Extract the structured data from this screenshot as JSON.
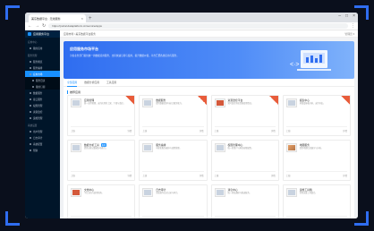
{
  "browser": {
    "tab_title": "美东数据平台 · 无线服务",
    "url": "https://portal.dataplatform.cn/service/apps"
  },
  "sidebar": {
    "app_name": "应用服务平台",
    "groups": [
      {
        "label": "应用中心",
        "items": [
          {
            "label": "我的应用"
          }
        ]
      },
      {
        "label": "服务管理",
        "items": [
          {
            "label": "服务概览"
          },
          {
            "label": "服务编排"
          },
          {
            "label": "应用市场",
            "active": true
          },
          {
            "label": "服务目录",
            "sub": true
          },
          {
            "label": "我的订阅",
            "sub": true
          },
          {
            "label": "数据服务"
          },
          {
            "label": "接口服务"
          },
          {
            "label": "权限管理"
          },
          {
            "label": "资源监控"
          },
          {
            "label": "运维管理"
          }
        ]
      },
      {
        "label": "系统设置",
        "items": [
          {
            "label": "用户管理"
          },
          {
            "label": "日志审计"
          },
          {
            "label": "系统配置"
          },
          {
            "label": "帮助"
          }
        ]
      }
    ]
  },
  "topbar": {
    "breadcrumb": "应用市场 / 美东数据平台服务",
    "right": "管理员 ▾"
  },
  "banner": {
    "title": "应用服务市场平台",
    "desc": "为各业务部门提供统一的数据应用服务，支持快速订阅与使用，提升数据价值。平台汇聚各类应用与服务。"
  },
  "tabs": [
    "全部应用",
    "数据分析应用",
    "工具应用"
  ],
  "section_title": "推荐应用",
  "cards": [
    {
      "title": "应用管理",
      "desc": "统一应用管理，支持应用的上架、下架与监控。",
      "thumb": "plain",
      "ribbon": true,
      "badge": "",
      "foot_left": "上线",
      "foot_right": "详情"
    },
    {
      "title": "数据服务",
      "desc": "提供数据查询与接口服务能力。",
      "thumb": "plain",
      "ribbon": true,
      "badge": "",
      "foot_left": "上线",
      "foot_right": "详情"
    },
    {
      "title": "资源监控平台",
      "desc": "实时监控系统资源使用情况。",
      "thumb": "red",
      "ribbon": true,
      "badge": "",
      "foot_left": "上线",
      "foot_right": "详情"
    },
    {
      "title": "报表中心",
      "desc": "多维度报表分析，支持导出。",
      "thumb": "plain",
      "ribbon": true,
      "badge": "",
      "foot_left": "上线",
      "foot_right": "详情"
    },
    {
      "title": "数据分析工具",
      "desc": "提供自助式数据分析能力。",
      "thumb": "plain",
      "ribbon": false,
      "badge": "推荐",
      "foot_left": "上线",
      "foot_right": "详情"
    },
    {
      "title": "服务编排",
      "desc": "可视化服务编排与流程管理。",
      "thumb": "plain",
      "ribbon": false,
      "badge": "",
      "foot_left": "上线",
      "foot_right": "详情"
    },
    {
      "title": "权限管理中心",
      "desc": "统一的用户与角色权限配置。",
      "thumb": "plain",
      "ribbon": false,
      "badge": "",
      "foot_left": "上线",
      "foot_right": "详情"
    },
    {
      "title": "地图服务",
      "desc": "提供地理信息展示与分析。",
      "thumb": "img",
      "ribbon": false,
      "badge": "",
      "foot_left": "上线",
      "foot_right": "详情"
    },
    {
      "title": "文档中心",
      "desc": "平台文档与使用指南。",
      "thumb": "red",
      "ribbon": false,
      "badge": "",
      "foot_left": "上线",
      "foot_right": "详情"
    },
    {
      "title": "日志审计",
      "desc": "系统操作日志记录与审计。",
      "thumb": "plain",
      "ribbon": false,
      "badge": "",
      "foot_left": "上线",
      "foot_right": "详情"
    },
    {
      "title": "消息中心",
      "desc": "统一消息通知与推送服务。",
      "thumb": "plain",
      "ribbon": false,
      "badge": "",
      "foot_left": "上线",
      "foot_right": "详情"
    },
    {
      "title": "运维工具箱",
      "desc": "常用运维工具集合。",
      "thumb": "plain",
      "ribbon": false,
      "badge": "",
      "foot_left": "上线",
      "foot_right": "详情"
    }
  ]
}
